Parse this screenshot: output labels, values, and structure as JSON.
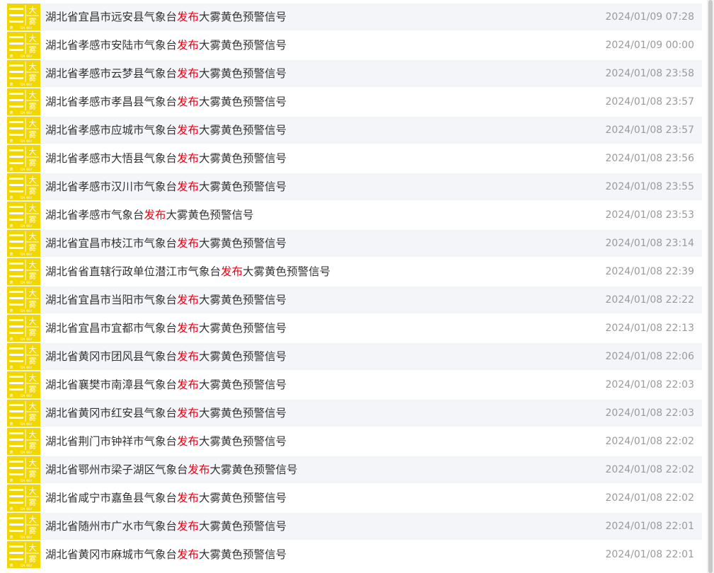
{
  "colors": {
    "icon_bg": "#f2d600",
    "verb": "#e60012",
    "title": "#333333",
    "time": "#9a9a9a"
  },
  "icon": {
    "name": "yellow-fog-warning-icon",
    "char_top": "大",
    "char_bottom": "雾",
    "level_char": "黄",
    "pinyin": "DA WU"
  },
  "warnings": [
    {
      "prefix": "湖北省宜昌市远安县气象台",
      "verb": "发布",
      "suffix": "大雾黄色预警信号",
      "time": "2024/01/09 07:28"
    },
    {
      "prefix": "湖北省孝感市安陆市气象台",
      "verb": "发布",
      "suffix": "大雾黄色预警信号",
      "time": "2024/01/09 00:00"
    },
    {
      "prefix": "湖北省孝感市云梦县气象台",
      "verb": "发布",
      "suffix": "大雾黄色预警信号",
      "time": "2024/01/08 23:58"
    },
    {
      "prefix": "湖北省孝感市孝昌县气象台",
      "verb": "发布",
      "suffix": "大雾黄色预警信号",
      "time": "2024/01/08 23:57"
    },
    {
      "prefix": "湖北省孝感市应城市气象台",
      "verb": "发布",
      "suffix": "大雾黄色预警信号",
      "time": "2024/01/08 23:57"
    },
    {
      "prefix": "湖北省孝感市大悟县气象台",
      "verb": "发布",
      "suffix": "大雾黄色预警信号",
      "time": "2024/01/08 23:56"
    },
    {
      "prefix": "湖北省孝感市汉川市气象台",
      "verb": "发布",
      "suffix": "大雾黄色预警信号",
      "time": "2024/01/08 23:55"
    },
    {
      "prefix": "湖北省孝感市气象台",
      "verb": "发布",
      "suffix": "大雾黄色预警信号",
      "time": "2024/01/08 23:53"
    },
    {
      "prefix": "湖北省宜昌市枝江市气象台",
      "verb": "发布",
      "suffix": "大雾黄色预警信号",
      "time": "2024/01/08 23:14"
    },
    {
      "prefix": "湖北省省直辖行政单位潜江市气象台",
      "verb": "发布",
      "suffix": "大雾黄色预警信号",
      "time": "2024/01/08 22:39"
    },
    {
      "prefix": "湖北省宜昌市当阳市气象台",
      "verb": "发布",
      "suffix": "大雾黄色预警信号",
      "time": "2024/01/08 22:22"
    },
    {
      "prefix": "湖北省宜昌市宜都市气象台",
      "verb": "发布",
      "suffix": "大雾黄色预警信号",
      "time": "2024/01/08 22:13"
    },
    {
      "prefix": "湖北省黄冈市团风县气象台",
      "verb": "发布",
      "suffix": "大雾黄色预警信号",
      "time": "2024/01/08 22:06"
    },
    {
      "prefix": "湖北省襄樊市南漳县气象台",
      "verb": "发布",
      "suffix": "大雾黄色预警信号",
      "time": "2024/01/08 22:03"
    },
    {
      "prefix": "湖北省黄冈市红安县气象台",
      "verb": "发布",
      "suffix": "大雾黄色预警信号",
      "time": "2024/01/08 22:03"
    },
    {
      "prefix": "湖北省荆门市钟祥市气象台",
      "verb": "发布",
      "suffix": "大雾黄色预警信号",
      "time": "2024/01/08 22:02"
    },
    {
      "prefix": "湖北省鄂州市梁子湖区气象台",
      "verb": "发布",
      "suffix": "大雾黄色预警信号",
      "time": "2024/01/08 22:02"
    },
    {
      "prefix": "湖北省咸宁市嘉鱼县气象台",
      "verb": "发布",
      "suffix": "大雾黄色预警信号",
      "time": "2024/01/08 22:02"
    },
    {
      "prefix": "湖北省随州市广水市气象台",
      "verb": "发布",
      "suffix": "大雾黄色预警信号",
      "time": "2024/01/08 22:01"
    },
    {
      "prefix": "湖北省黄冈市麻城市气象台",
      "verb": "发布",
      "suffix": "大雾黄色预警信号",
      "time": "2024/01/08 22:01"
    }
  ]
}
